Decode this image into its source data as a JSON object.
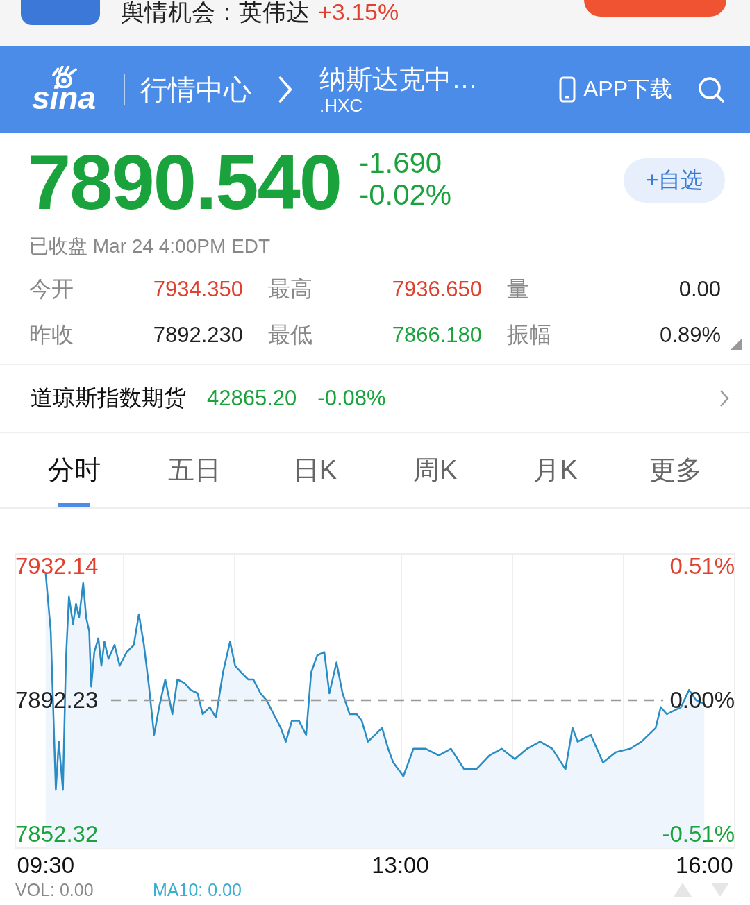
{
  "banner": {
    "text": "舆情机会：英伟达",
    "change": "+3.15%"
  },
  "header": {
    "logo": "sina",
    "section": "行情中心",
    "title": "纳斯达克中…",
    "code": ".HXC",
    "app_link": "APP下载"
  },
  "quote": {
    "price": "7890.540",
    "change": "-1.690",
    "change_pct": "-0.02%",
    "color": "#1aa33d",
    "watch_button": "+自选",
    "status": "已收盘 Mar 24 4:00PM EDT"
  },
  "stats": [
    {
      "label": "今开",
      "value": "7934.350",
      "color": "#e0412f"
    },
    {
      "label": "最高",
      "value": "7936.650",
      "color": "#e0412f"
    },
    {
      "label": "量",
      "value": "0.00",
      "color": "#222222"
    },
    {
      "label": "昨收",
      "value": "7892.230",
      "color": "#222222"
    },
    {
      "label": "最低",
      "value": "7866.180",
      "color": "#1aa33d"
    },
    {
      "label": "振幅",
      "value": "0.89%",
      "color": "#222222"
    }
  ],
  "related": {
    "name": "道琼斯指数期货",
    "price": "42865.20",
    "change": "-0.08%",
    "color": "#1aa33d"
  },
  "tabs": [
    {
      "label": "分时",
      "selected": true
    },
    {
      "label": "五日",
      "selected": false
    },
    {
      "label": "日K",
      "selected": false
    },
    {
      "label": "周K",
      "selected": false
    },
    {
      "label": "月K",
      "selected": false
    },
    {
      "label": "更多",
      "selected": false
    }
  ],
  "chart": {
    "right_labels": [
      "0.51%",
      "0.00%",
      "-0.51%"
    ],
    "vol": "VOL: 0.00",
    "ma10": "MA10: 0.00",
    "chart_data": {
      "type": "area",
      "ref_lines": [
        {
          "axis": "y",
          "value": 7892.23
        }
      ],
      "ylim": [
        7848.18,
        7935.86
      ],
      "xlim": [
        9.2,
        16.3
      ],
      "yticks": [
        {
          "value": 7932.14,
          "label": "7932.14"
        },
        {
          "value": 7892.23,
          "label": "7892.23"
        },
        {
          "value": 7852.32,
          "label": "7852.32"
        }
      ],
      "xticks": [
        {
          "value": 9.5,
          "label": "09:30"
        },
        {
          "value": 13,
          "label": "13:00"
        },
        {
          "value": 16,
          "label": "16:00"
        }
      ],
      "x": [
        9.5,
        9.55,
        9.6,
        9.63,
        9.67,
        9.7,
        9.73,
        9.77,
        9.8,
        9.83,
        9.87,
        9.9,
        9.93,
        9.95,
        9.98,
        10.02,
        10.05,
        10.08,
        10.12,
        10.18,
        10.23,
        10.3,
        10.37,
        10.42,
        10.47,
        10.52,
        10.57,
        10.62,
        10.68,
        10.75,
        10.8,
        10.87,
        10.93,
        11.0,
        11.05,
        11.12,
        11.18,
        11.25,
        11.32,
        11.37,
        11.43,
        11.5,
        11.55,
        11.62,
        11.68,
        11.75,
        11.82,
        11.87,
        11.93,
        12.0,
        12.07,
        12.12,
        12.18,
        12.25,
        12.3,
        12.37,
        12.43,
        12.5,
        12.57,
        12.62,
        12.68,
        12.75,
        12.82,
        12.88,
        12.93,
        13.03,
        13.13,
        13.25,
        13.38,
        13.5,
        13.63,
        13.75,
        13.88,
        14.0,
        14.13,
        14.25,
        14.38,
        14.5,
        14.63,
        14.7,
        14.75,
        14.88,
        15.0,
        15.13,
        15.27,
        15.38,
        15.52,
        15.57,
        15.63,
        15.77,
        15.85,
        15.92,
        16.0
      ],
      "series": [
        {
          "color": "#2a8cc4",
          "values": [
            7930.0,
            7912.8,
            7865.5,
            7879.9,
            7865.5,
            7904.6,
            7923.1,
            7914.9,
            7921.0,
            7916.9,
            7927.2,
            7916.9,
            7912.8,
            7896.3,
            7906.6,
            7910.7,
            7902.5,
            7909.7,
            7904.6,
            7908.7,
            7902.5,
            7906.6,
            7908.7,
            7917.9,
            7908.7,
            7896.3,
            7881.9,
            7890.2,
            7898.4,
            7888.1,
            7898.4,
            7897.4,
            7895.3,
            7894.3,
            7888.1,
            7890.2,
            7887.1,
            7900.5,
            7909.7,
            7902.5,
            7900.5,
            7898.4,
            7898.4,
            7894.3,
            7892.2,
            7888.1,
            7884.0,
            7879.9,
            7886.1,
            7886.1,
            7881.9,
            7900.5,
            7905.6,
            7906.6,
            7894.3,
            7903.5,
            7894.3,
            7888.1,
            7888.1,
            7886.1,
            7879.9,
            7881.9,
            7884.0,
            7877.8,
            7873.7,
            7869.6,
            7877.8,
            7877.8,
            7875.8,
            7877.8,
            7871.7,
            7871.7,
            7875.8,
            7877.8,
            7874.7,
            7877.8,
            7879.9,
            7877.8,
            7871.7,
            7884.0,
            7879.9,
            7881.9,
            7873.7,
            7876.8,
            7877.8,
            7879.9,
            7884.0,
            7890.2,
            7888.1,
            7890.2,
            7895.3,
            7892.2,
            7891.2
          ]
        }
      ]
    }
  }
}
